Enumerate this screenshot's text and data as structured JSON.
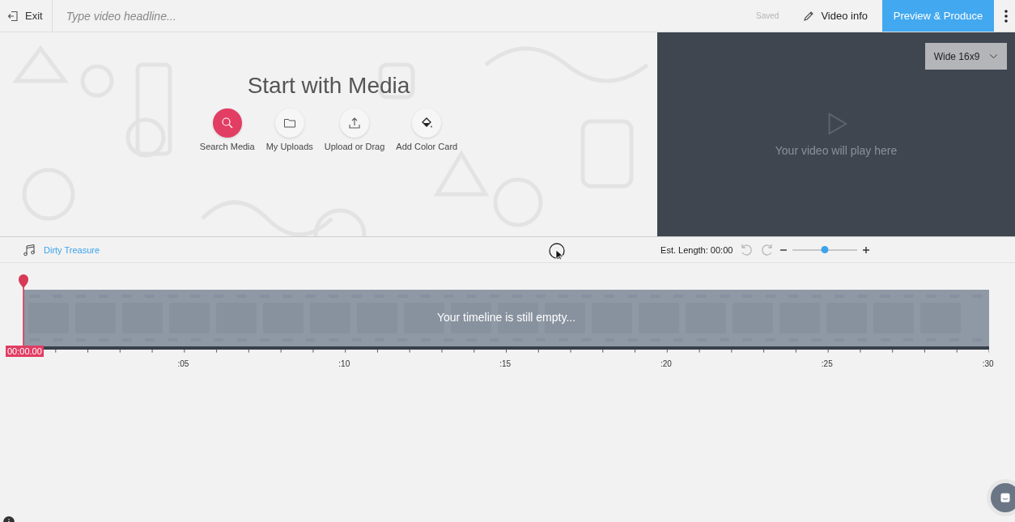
{
  "topbar": {
    "exit": "Exit",
    "headline": {
      "placeholder": "Type video headline..."
    },
    "status": "Saved",
    "video_info": "Video info",
    "produce": "Preview & Produce"
  },
  "media": {
    "title": "Start with Media",
    "actions": [
      {
        "label": "Search Media",
        "kind": "search",
        "selected": true
      },
      {
        "label": "My Uploads",
        "kind": "folder",
        "selected": false
      },
      {
        "label": "Upload or Drag",
        "kind": "upload",
        "selected": false
      },
      {
        "label": "Add Color Card",
        "kind": "paint",
        "selected": false
      }
    ]
  },
  "preview": {
    "aspect": "Wide 16x9",
    "message": "Your video will play here"
  },
  "timeline": {
    "track": "Dirty Treasure",
    "est_length": "Est. Length: 00:00",
    "zoom": {
      "level": 0.5
    },
    "empty_message": "Your timeline is still empty...",
    "playhead": "00:00.00",
    "ticks": [
      ":05",
      ":10",
      ":15",
      ":20",
      ":25",
      ":30"
    ]
  }
}
